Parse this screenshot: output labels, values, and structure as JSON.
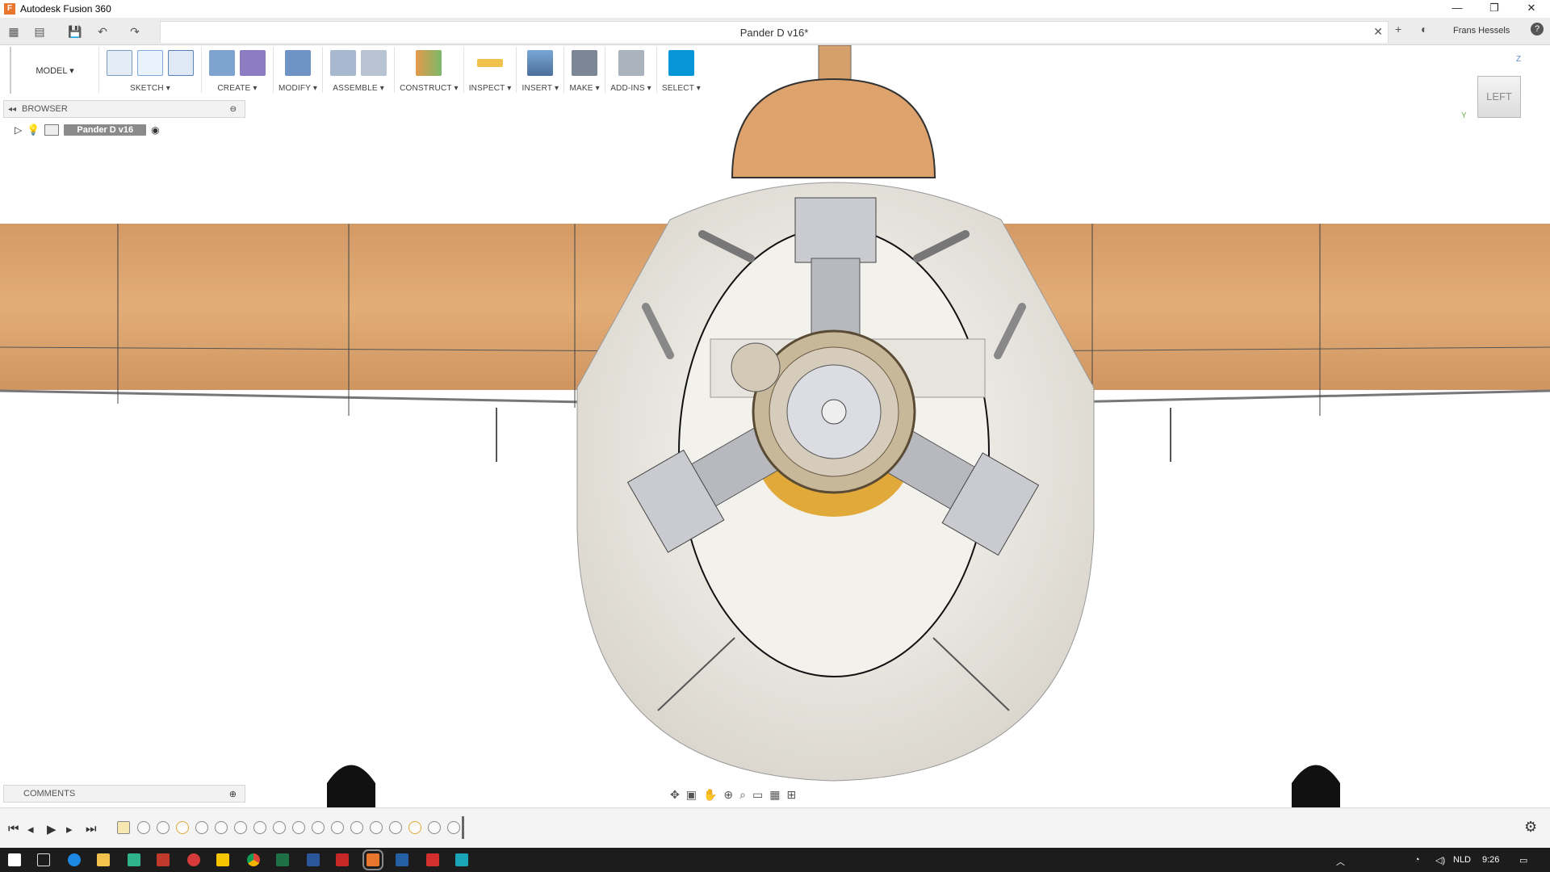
{
  "window": {
    "title": "Autodesk Fusion 360",
    "app_icon_letter": "F",
    "minimize": "—",
    "maximize": "❐",
    "close": "✕"
  },
  "tabs": {
    "document_title": "Pander D v16*",
    "close_icon": "✕",
    "new_tab_icon": "+",
    "user": "Frans Hessels",
    "help": "?"
  },
  "toolbar": {
    "workspace": "MODEL ▾",
    "groups": [
      {
        "label": "SKETCH ▾"
      },
      {
        "label": "CREATE ▾"
      },
      {
        "label": "MODIFY ▾"
      },
      {
        "label": "ASSEMBLE ▾"
      },
      {
        "label": "CONSTRUCT ▾"
      },
      {
        "label": "INSPECT ▾"
      },
      {
        "label": "INSERT ▾"
      },
      {
        "label": "MAKE ▾"
      },
      {
        "label": "ADD-INS ▾"
      },
      {
        "label": "SELECT ▾"
      }
    ]
  },
  "browser": {
    "title": "BROWSER",
    "root_node": "Pander D v16"
  },
  "viewcube": {
    "face": "LEFT",
    "axis_z": "Z",
    "axis_y": "Y"
  },
  "comments": {
    "title": "COMMENTS"
  },
  "taskbar": {
    "language": "NLD",
    "time": "9:26"
  },
  "colors": {
    "accent": "#0696d7",
    "wood": "#d9a06a",
    "cowling": "#ebe8e2",
    "engine_gold": "#e0a93a",
    "taskbar": "#1c1c1c"
  }
}
